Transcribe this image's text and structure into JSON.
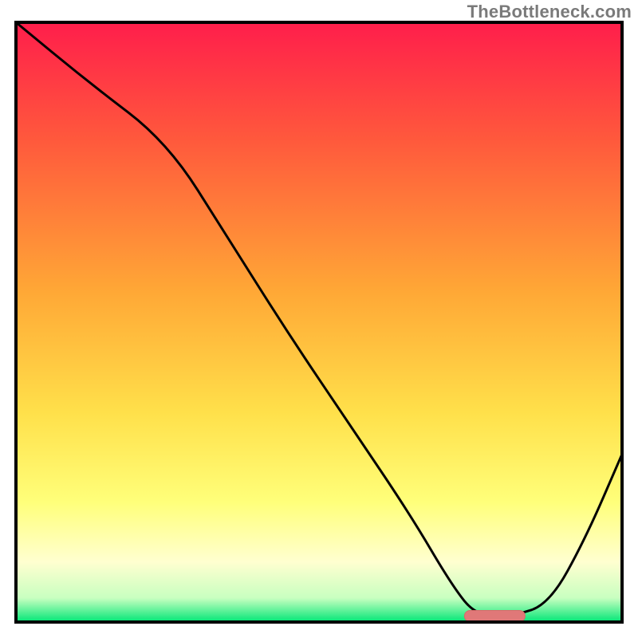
{
  "watermark": "TheBottleneck.com",
  "colors": {
    "frame": "#000000",
    "curve": "#000000",
    "marker_fill": "#e07878",
    "marker_stroke": "#d86a6a",
    "grad_top": "#ff1e4b",
    "grad_mid_high": "#ff7a3a",
    "grad_mid": "#ffd23a",
    "grad_low": "#ffff9a",
    "grad_pale": "#ffffe6",
    "grad_green": "#00e676"
  },
  "chart_data": {
    "type": "line",
    "title": "",
    "xlabel": "",
    "ylabel": "",
    "xlim": [
      0,
      100
    ],
    "ylim": [
      0,
      100
    ],
    "x": [
      0,
      12,
      25,
      35,
      45,
      55,
      65,
      72,
      76,
      82,
      88,
      94,
      100
    ],
    "values": [
      100,
      90,
      80,
      64,
      48,
      33,
      18,
      6,
      1,
      1,
      3,
      14,
      28
    ],
    "marker": {
      "x_start": 74,
      "x_end": 84,
      "y": 1
    },
    "gradient_stops": [
      {
        "offset": 0.0,
        "color": "#ff1e4b"
      },
      {
        "offset": 0.2,
        "color": "#ff5a3c"
      },
      {
        "offset": 0.45,
        "color": "#ffa836"
      },
      {
        "offset": 0.65,
        "color": "#ffe04a"
      },
      {
        "offset": 0.8,
        "color": "#ffff7a"
      },
      {
        "offset": 0.9,
        "color": "#ffffd0"
      },
      {
        "offset": 0.96,
        "color": "#c8ffc0"
      },
      {
        "offset": 1.0,
        "color": "#00e676"
      }
    ]
  }
}
